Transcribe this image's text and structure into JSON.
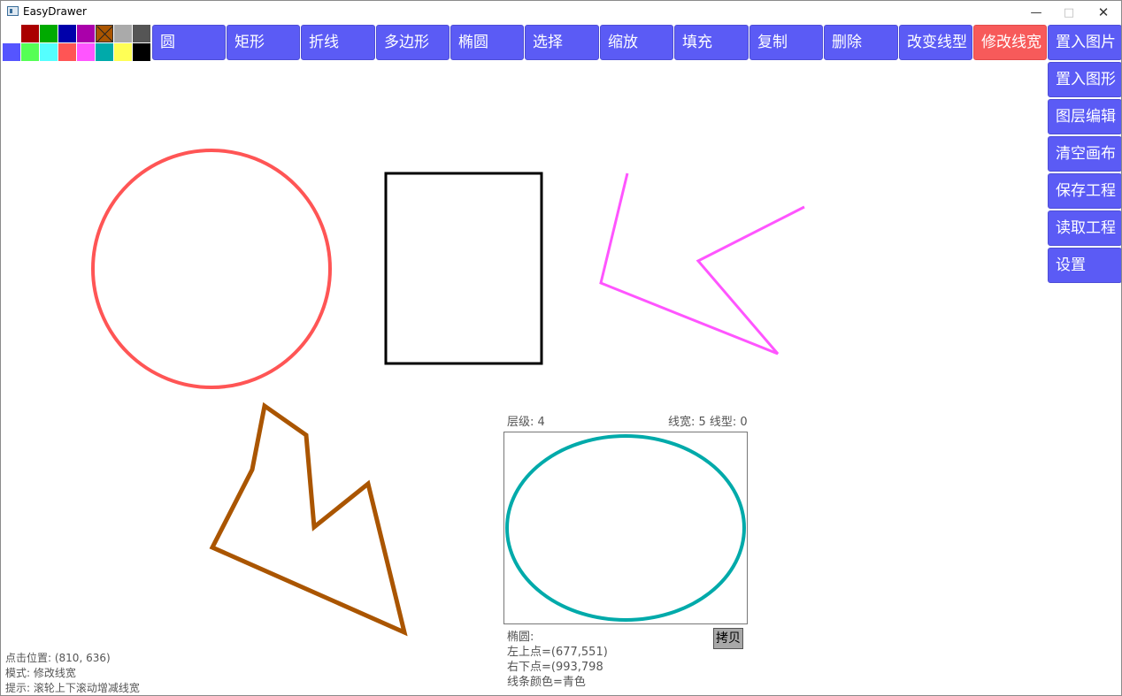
{
  "window": {
    "title": "EasyDrawer"
  },
  "palette": {
    "swatches": [
      {
        "color": "#aa0000"
      },
      {
        "color": "#00aa00"
      },
      {
        "color": "#0000aa"
      },
      {
        "color": "#aa00aa"
      },
      {
        "color": "#aa5500",
        "crossed": true
      },
      {
        "color": "#aaaaaa"
      },
      {
        "color": "#555555"
      },
      {
        "color": "#5555ff"
      },
      {
        "color": "#55ff55"
      },
      {
        "color": "#55ffff"
      },
      {
        "color": "#ff5555"
      },
      {
        "color": "#ff55ff"
      },
      {
        "color": "#00aaaa"
      },
      {
        "color": "#ffff55"
      },
      {
        "color": "#000000"
      }
    ]
  },
  "toolbar": {
    "circle": "圆",
    "rectangle": "矩形",
    "polyline": "折线",
    "polygon": "多边形",
    "ellipse": "椭圆",
    "select": "选择",
    "scale": "缩放",
    "fill": "填充",
    "copy": "复制",
    "delete": "删除",
    "change_line_style": "改变线型",
    "modify_line_width": "修改线宽"
  },
  "sidebar": {
    "insert_image": "置入图片",
    "insert_shape": "置入图形",
    "layer_edit": "图层编辑",
    "clear_canvas": "清空画布",
    "save_project": "保存工程",
    "load_project": "读取工程",
    "settings": "设置"
  },
  "colors": {
    "button": "#5b5bf5",
    "active_button": "#f75a5a",
    "circle_stroke": "#ff5555",
    "rect_stroke": "#000000",
    "polyline_stroke": "#ff55ff",
    "polygon_stroke": "#aa5500",
    "ellipse_stroke": "#00aaaa"
  },
  "info_panel": {
    "layer": "层级: 4",
    "line_width_type": "线宽: 5  线型: 0",
    "shape_name": "椭圆:",
    "top_left": "左上点=(677,551)",
    "bottom_right": "右下点=(993,798",
    "line_color": "线条颜色=青色",
    "copy_button": "拷贝"
  },
  "status": {
    "click_position": "点击位置: (810, 636)",
    "mode": "模式: 修改线宽",
    "hint": "提示: 滚轮上下滚动增减线宽"
  }
}
